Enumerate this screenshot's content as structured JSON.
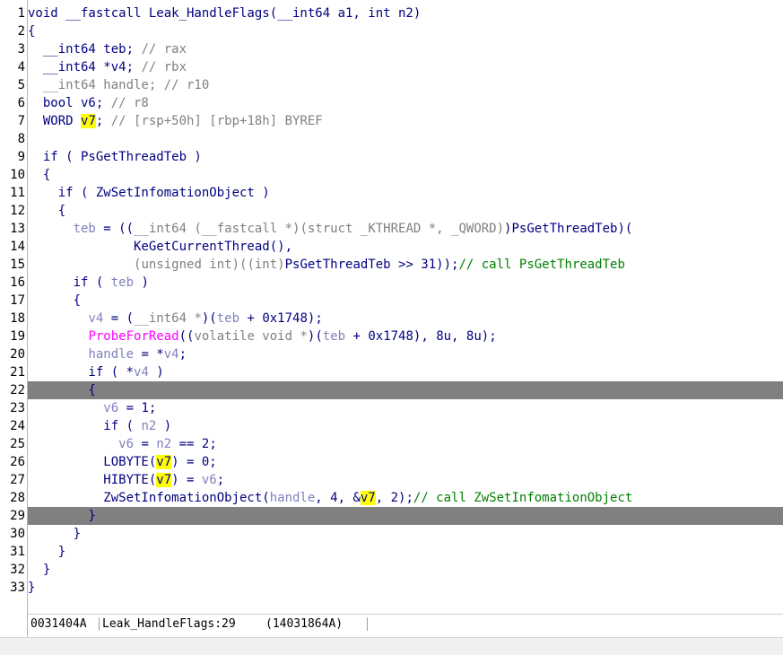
{
  "gutter": [
    "1",
    "2",
    "3",
    "4",
    "5",
    "6",
    "7",
    "8",
    "9",
    "10",
    "11",
    "12",
    "13",
    "14",
    "15",
    "16",
    "17",
    "18",
    "19",
    "20",
    "21",
    "22",
    "23",
    "24",
    "25",
    "26",
    "27",
    "28",
    "29",
    "30",
    "31",
    "32",
    "33"
  ],
  "lines": [
    {
      "hl": false,
      "tokens": [
        {
          "t": "void __fastcall Leak_HandleFlags(__int64 a1, int n2)",
          "c": "plain"
        }
      ]
    },
    {
      "hl": false,
      "tokens": [
        {
          "t": "{",
          "c": "plain"
        }
      ]
    },
    {
      "hl": false,
      "tokens": [
        {
          "t": "  __int64 teb; ",
          "c": "plain"
        },
        {
          "t": "// rax",
          "c": "gray"
        }
      ]
    },
    {
      "hl": false,
      "tokens": [
        {
          "t": "  __int64 *v4; ",
          "c": "plain"
        },
        {
          "t": "// rbx",
          "c": "gray"
        }
      ]
    },
    {
      "hl": false,
      "tokens": [
        {
          "t": "  __int64 handle; ",
          "c": "gray"
        },
        {
          "t": "// r10",
          "c": "gray"
        }
      ]
    },
    {
      "hl": false,
      "tokens": [
        {
          "t": "  bool v6; ",
          "c": "plain"
        },
        {
          "t": "// r8",
          "c": "gray"
        }
      ]
    },
    {
      "hl": false,
      "tokens": [
        {
          "t": "  WORD ",
          "c": "plain"
        },
        {
          "t": "v7",
          "c": "hlvar"
        },
        {
          "t": "; ",
          "c": "plain"
        },
        {
          "t": "// [rsp+50h] [rbp+18h] BYREF",
          "c": "gray"
        }
      ]
    },
    {
      "hl": false,
      "tokens": [
        {
          "t": "",
          "c": "plain"
        }
      ]
    },
    {
      "hl": false,
      "tokens": [
        {
          "t": "  if ( PsGetThreadTeb )",
          "c": "plain"
        }
      ]
    },
    {
      "hl": false,
      "tokens": [
        {
          "t": "  {",
          "c": "plain"
        }
      ]
    },
    {
      "hl": false,
      "tokens": [
        {
          "t": "    if ( ZwSetInfomationObject )",
          "c": "plain"
        }
      ]
    },
    {
      "hl": false,
      "tokens": [
        {
          "t": "    {",
          "c": "plain"
        }
      ]
    },
    {
      "hl": false,
      "tokens": [
        {
          "t": "      ",
          "c": "plain"
        },
        {
          "t": "teb",
          "c": "var"
        },
        {
          "t": " = ((",
          "c": "plain"
        },
        {
          "t": "__int64 (__fastcall *)(struct _KTHREAD *, _QWORD)",
          "c": "gray"
        },
        {
          "t": ")PsGetThreadTeb)(",
          "c": "plain"
        }
      ]
    },
    {
      "hl": false,
      "tokens": [
        {
          "t": "              KeGetCurrentThread(),",
          "c": "plain"
        }
      ]
    },
    {
      "hl": false,
      "tokens": [
        {
          "t": "              ",
          "c": "plain"
        },
        {
          "t": "(unsigned int)((int)",
          "c": "gray"
        },
        {
          "t": "PsGetThreadTeb >> 31));",
          "c": "plain"
        },
        {
          "t": "// call PsGetThreadTeb",
          "c": "comment"
        }
      ]
    },
    {
      "hl": false,
      "tokens": [
        {
          "t": "      if ( ",
          "c": "plain"
        },
        {
          "t": "teb",
          "c": "var"
        },
        {
          "t": " )",
          "c": "plain"
        }
      ]
    },
    {
      "hl": false,
      "tokens": [
        {
          "t": "      {",
          "c": "plain"
        }
      ]
    },
    {
      "hl": false,
      "tokens": [
        {
          "t": "        ",
          "c": "plain"
        },
        {
          "t": "v4",
          "c": "var"
        },
        {
          "t": " = (",
          "c": "plain"
        },
        {
          "t": "__int64 *",
          "c": "gray"
        },
        {
          "t": ")(",
          "c": "plain"
        },
        {
          "t": "teb",
          "c": "var"
        },
        {
          "t": " + 0x1748);",
          "c": "plain"
        }
      ]
    },
    {
      "hl": false,
      "tokens": [
        {
          "t": "        ",
          "c": "plain"
        },
        {
          "t": "ProbeForRead",
          "c": "import"
        },
        {
          "t": "((",
          "c": "plain"
        },
        {
          "t": "volatile void *",
          "c": "gray"
        },
        {
          "t": ")(",
          "c": "plain"
        },
        {
          "t": "teb",
          "c": "var"
        },
        {
          "t": " + 0x1748), 8u, 8u);",
          "c": "plain"
        }
      ]
    },
    {
      "hl": false,
      "tokens": [
        {
          "t": "        ",
          "c": "plain"
        },
        {
          "t": "handle",
          "c": "var"
        },
        {
          "t": " = *",
          "c": "plain"
        },
        {
          "t": "v4",
          "c": "var"
        },
        {
          "t": ";",
          "c": "plain"
        }
      ]
    },
    {
      "hl": false,
      "tokens": [
        {
          "t": "        if ( *",
          "c": "plain"
        },
        {
          "t": "v4",
          "c": "var"
        },
        {
          "t": " )",
          "c": "plain"
        }
      ]
    },
    {
      "hl": true,
      "tokens": [
        {
          "t": "        {",
          "c": "plain"
        }
      ]
    },
    {
      "hl": false,
      "tokens": [
        {
          "t": "          ",
          "c": "plain"
        },
        {
          "t": "v6",
          "c": "var"
        },
        {
          "t": " = 1;",
          "c": "plain"
        }
      ]
    },
    {
      "hl": false,
      "tokens": [
        {
          "t": "          if ( ",
          "c": "plain"
        },
        {
          "t": "n2",
          "c": "var"
        },
        {
          "t": " )",
          "c": "plain"
        }
      ]
    },
    {
      "hl": false,
      "tokens": [
        {
          "t": "            ",
          "c": "plain"
        },
        {
          "t": "v6",
          "c": "var"
        },
        {
          "t": " = ",
          "c": "plain"
        },
        {
          "t": "n2",
          "c": "var"
        },
        {
          "t": " == 2;",
          "c": "plain"
        }
      ]
    },
    {
      "hl": false,
      "tokens": [
        {
          "t": "          LOBYTE(",
          "c": "plain"
        },
        {
          "t": "v7",
          "c": "hlvar"
        },
        {
          "t": ") = 0;",
          "c": "plain"
        }
      ]
    },
    {
      "hl": false,
      "tokens": [
        {
          "t": "          HIBYTE(",
          "c": "plain"
        },
        {
          "t": "v7",
          "c": "hlvar"
        },
        {
          "t": ") = ",
          "c": "plain"
        },
        {
          "t": "v6",
          "c": "var"
        },
        {
          "t": ";",
          "c": "plain"
        }
      ]
    },
    {
      "hl": false,
      "tokens": [
        {
          "t": "          ZwSetInfomationObject(",
          "c": "plain"
        },
        {
          "t": "handle",
          "c": "var"
        },
        {
          "t": ", 4, &",
          "c": "plain"
        },
        {
          "t": "v7",
          "c": "hlvar"
        },
        {
          "t": ", 2);",
          "c": "plain"
        },
        {
          "t": "// call ZwSetInfomationObject",
          "c": "comment"
        }
      ]
    },
    {
      "hl": true,
      "tokens": [
        {
          "t": "        }",
          "c": "plain"
        }
      ]
    },
    {
      "hl": false,
      "tokens": [
        {
          "t": "      }",
          "c": "plain"
        }
      ]
    },
    {
      "hl": false,
      "tokens": [
        {
          "t": "    }",
          "c": "plain"
        }
      ]
    },
    {
      "hl": false,
      "tokens": [
        {
          "t": "  }",
          "c": "plain"
        }
      ]
    },
    {
      "hl": false,
      "tokens": [
        {
          "t": "}",
          "c": "plain"
        }
      ]
    }
  ],
  "status": {
    "address": "0031404A",
    "location": "Leak_HandleFlags:29",
    "ea": "(14031864A)"
  },
  "colors": {
    "code_text": "#000080",
    "variable": "#8080c0",
    "comment": "#008000",
    "gray_type": "#808080",
    "import_func": "#ff00ff",
    "highlight_bg": "#ffff00",
    "current_line": "#808080"
  }
}
